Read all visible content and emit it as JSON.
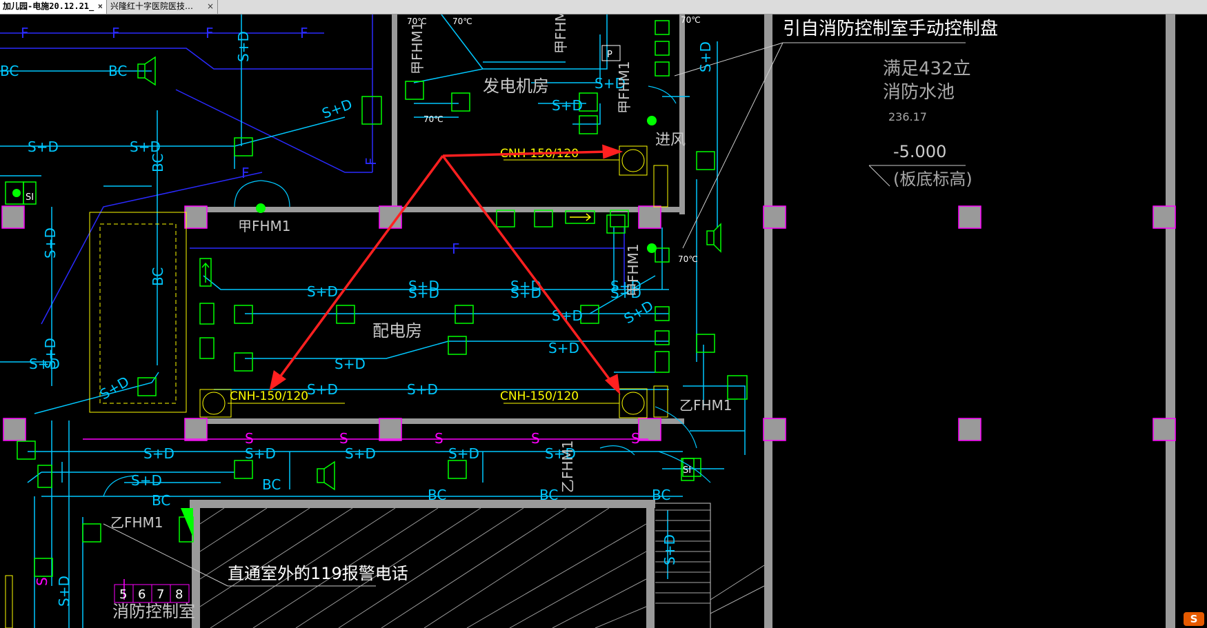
{
  "tabs": [
    {
      "label": "加儿园-电施20.12.21_",
      "close": "×",
      "active": true
    },
    {
      "label": "兴隆红十字医院医技…",
      "close": "×",
      "active": false
    }
  ],
  "drawing": {
    "annotations": {
      "manual_panel": "引自消防控制室手动控制盘",
      "alarm_phone": "直通室外的119报警电话"
    },
    "room_labels": {
      "generator": "发电机房",
      "distribution": "配电房",
      "fire_control": "消防控制室",
      "air_intake": "进风"
    },
    "water_tank": {
      "line1": "满足432立",
      "line2": "消防水池",
      "value": "236.17",
      "elevation": "-5.000",
      "elevation_note": "(板底标高)"
    },
    "cnh_label": "CNH-150/120",
    "wire_labels": {
      "sd": "S+D",
      "bc": "BC",
      "f": "F",
      "s": "S"
    },
    "door_labels": {
      "jia": "甲FHM1",
      "yi": "乙FHM1"
    },
    "device_labels": {
      "si": "SI",
      "p": "P",
      "temp": "70℃"
    },
    "terminal_numbers": [
      "5",
      "6",
      "7",
      "8"
    ]
  },
  "logo_text": "S",
  "colors": {
    "wall": "#a0a0a0",
    "cyan": "#00c8ff",
    "green": "#00ff00",
    "yellow": "#ffff00",
    "red": "#ff2020",
    "blue": "#2a2aff",
    "magenta": "#ff00ff"
  }
}
